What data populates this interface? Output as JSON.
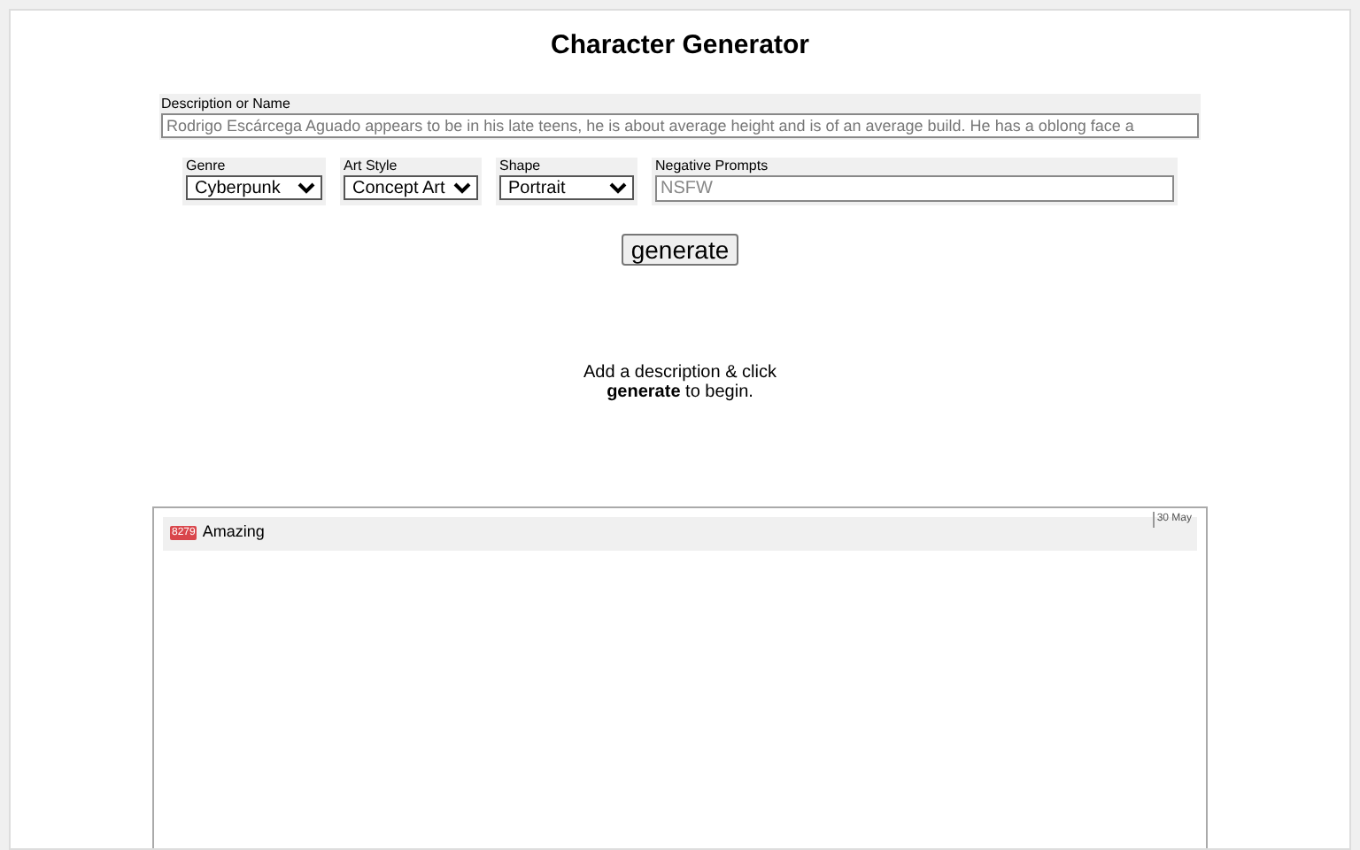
{
  "title": "Character Generator",
  "description": {
    "label": "Description or Name",
    "placeholder": "Rodrigo Escárcega Aguado appears to be in his late teens, he is about average height and is of an average build. He has a oblong face a"
  },
  "options": [
    {
      "kind": "select",
      "label": "Genre",
      "value": "Cyberpunk"
    },
    {
      "kind": "select",
      "label": "Art Style",
      "value": "Concept Art"
    },
    {
      "kind": "select",
      "label": "Shape",
      "value": "Portrait"
    },
    {
      "kind": "text",
      "label": "Negative Prompts",
      "placeholder": "NSFW"
    }
  ],
  "generate_button": "generate",
  "hint": "Add a description & click **generate** to begin.",
  "feed": {
    "badge": "8279",
    "title": "Amazing",
    "date": "30 May"
  }
}
